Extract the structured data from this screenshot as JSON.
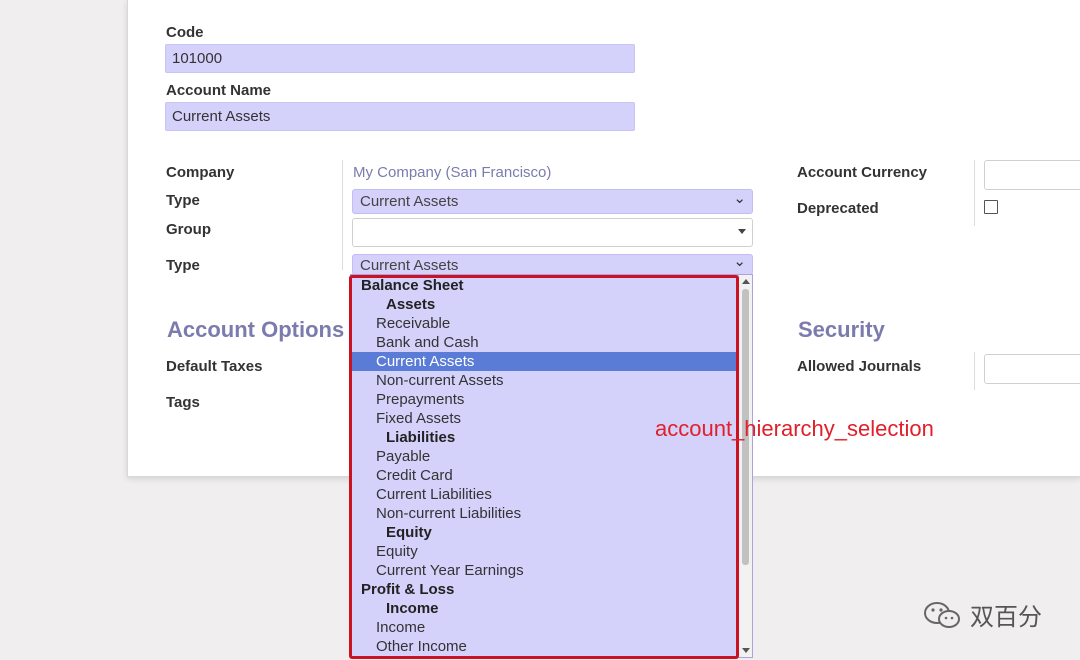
{
  "form": {
    "code_label": "Code",
    "code_value": "101000",
    "name_label": "Account Name",
    "name_value": "Current Assets",
    "company_label": "Company",
    "company_value": "My Company (San Francisco)",
    "type_label": "Type",
    "type_value": "Current Assets",
    "group_label": "Group",
    "group_value": "",
    "type2_label": "Type",
    "type2_value": "Current Assets",
    "account_currency_label": "Account Currency",
    "deprecated_label": "Deprecated",
    "options_section": "Account Options",
    "default_taxes_label": "Default Taxes",
    "tags_label": "Tags",
    "security_section": "Security",
    "allowed_journals_label": "Allowed Journals"
  },
  "dropdown": {
    "options": [
      {
        "label": "Balance Sheet",
        "level": 0,
        "selected": false
      },
      {
        "label": "Assets",
        "level": 1,
        "selected": false
      },
      {
        "label": "Receivable",
        "level": 2,
        "selected": false
      },
      {
        "label": "Bank and Cash",
        "level": 2,
        "selected": false
      },
      {
        "label": "Current Assets",
        "level": 2,
        "selected": true
      },
      {
        "label": "Non-current Assets",
        "level": 2,
        "selected": false
      },
      {
        "label": "Prepayments",
        "level": 2,
        "selected": false
      },
      {
        "label": "Fixed Assets",
        "level": 2,
        "selected": false
      },
      {
        "label": "Liabilities",
        "level": 1,
        "selected": false
      },
      {
        "label": "Payable",
        "level": 2,
        "selected": false
      },
      {
        "label": "Credit Card",
        "level": 2,
        "selected": false
      },
      {
        "label": "Current Liabilities",
        "level": 2,
        "selected": false
      },
      {
        "label": "Non-current Liabilities",
        "level": 2,
        "selected": false
      },
      {
        "label": "Equity",
        "level": 1,
        "selected": false
      },
      {
        "label": "Equity",
        "level": 2,
        "selected": false
      },
      {
        "label": "Current Year Earnings",
        "level": 2,
        "selected": false
      },
      {
        "label": "Profit & Loss",
        "level": 0,
        "selected": false
      },
      {
        "label": "Income",
        "level": 1,
        "selected": false
      },
      {
        "label": "Income",
        "level": 2,
        "selected": false
      },
      {
        "label": "Other Income",
        "level": 2,
        "selected": false
      }
    ]
  },
  "annotation": "account_hierarchy_selection",
  "watermark": "双百分",
  "colors": {
    "field_bg": "#d4d1fb",
    "section_title": "#7c7bad",
    "selected_option": "#5a7cd6",
    "highlight_border": "#cc1122",
    "annotation_text": "#e0202a"
  }
}
